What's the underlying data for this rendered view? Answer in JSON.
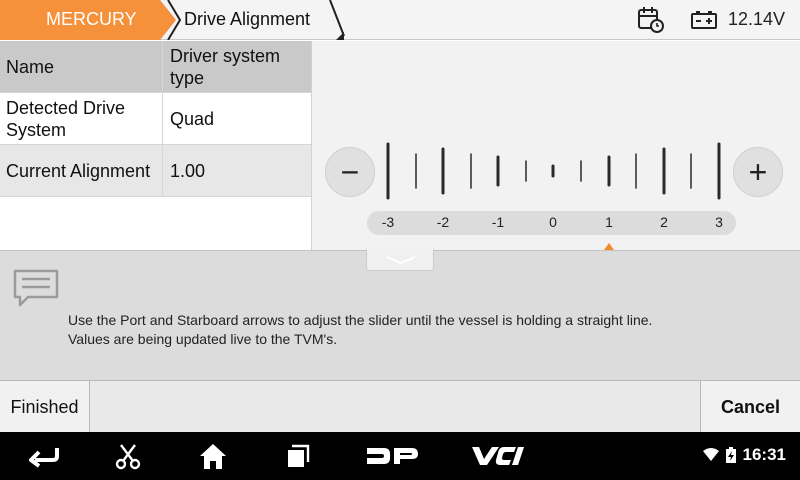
{
  "topbar": {
    "brand_tab": "MERCURY",
    "page_tab": "Drive Alignment",
    "calendar_icon": "calendar-clock-icon",
    "battery_icon": "battery-icon",
    "voltage": "12.14V",
    "brand_color": "#f4913a"
  },
  "table": {
    "header": {
      "col1": "Name",
      "col2": "Driver system type"
    },
    "rows": [
      {
        "name": "Detected Drive System",
        "value": "Quad"
      },
      {
        "name": "Current Alignment",
        "value": "1.00"
      }
    ]
  },
  "slider": {
    "minus_label": "−",
    "plus_label": "+",
    "scale": [
      "-3",
      "-2",
      "-1",
      "0",
      "1",
      "2",
      "3"
    ],
    "current_value": 1.0,
    "range": [
      -3,
      3
    ],
    "pointer_color": "#f08a2a"
  },
  "info": {
    "icon": "message-icon",
    "line1": "Use the Port and Starboard arrows to adjust the slider until the vessel is holding a straight line.",
    "line2": "Values are being updated live to the TVM's."
  },
  "footer": {
    "finished_label": "Finished",
    "cancel_label": "Cancel"
  },
  "navbar": {
    "icons": [
      "back-icon",
      "scissors-icon",
      "home-icon",
      "recent-apps-icon",
      "dp-logo-icon",
      "vci-logo-icon"
    ],
    "dp_text": "DP",
    "vci_text": "VCI",
    "time": "16:31"
  }
}
